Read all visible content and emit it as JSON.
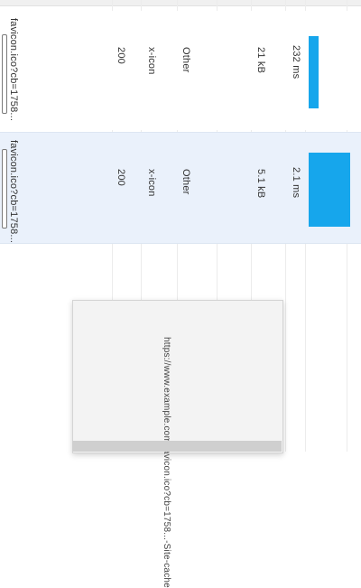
{
  "network_table": {
    "rows": [
      {
        "name": "favicon.ico?cb=1758...",
        "status": "200",
        "type": "x-icon",
        "initiator": "Other",
        "size": "21 kB",
        "time": "232 ms"
      },
      {
        "name": "favicon.ico?cb=1758...",
        "status": "200",
        "type": "x-icon",
        "initiator": "Other",
        "size": "5.1 kB",
        "time": "2.1 ms"
      }
    ],
    "waterfall_color": "#16a6ec",
    "selected_row_color": "#eaf1fb"
  },
  "tooltip": {
    "text": "https://www.example.com/favicon.ico?cb=1758...-Site-cache"
  }
}
